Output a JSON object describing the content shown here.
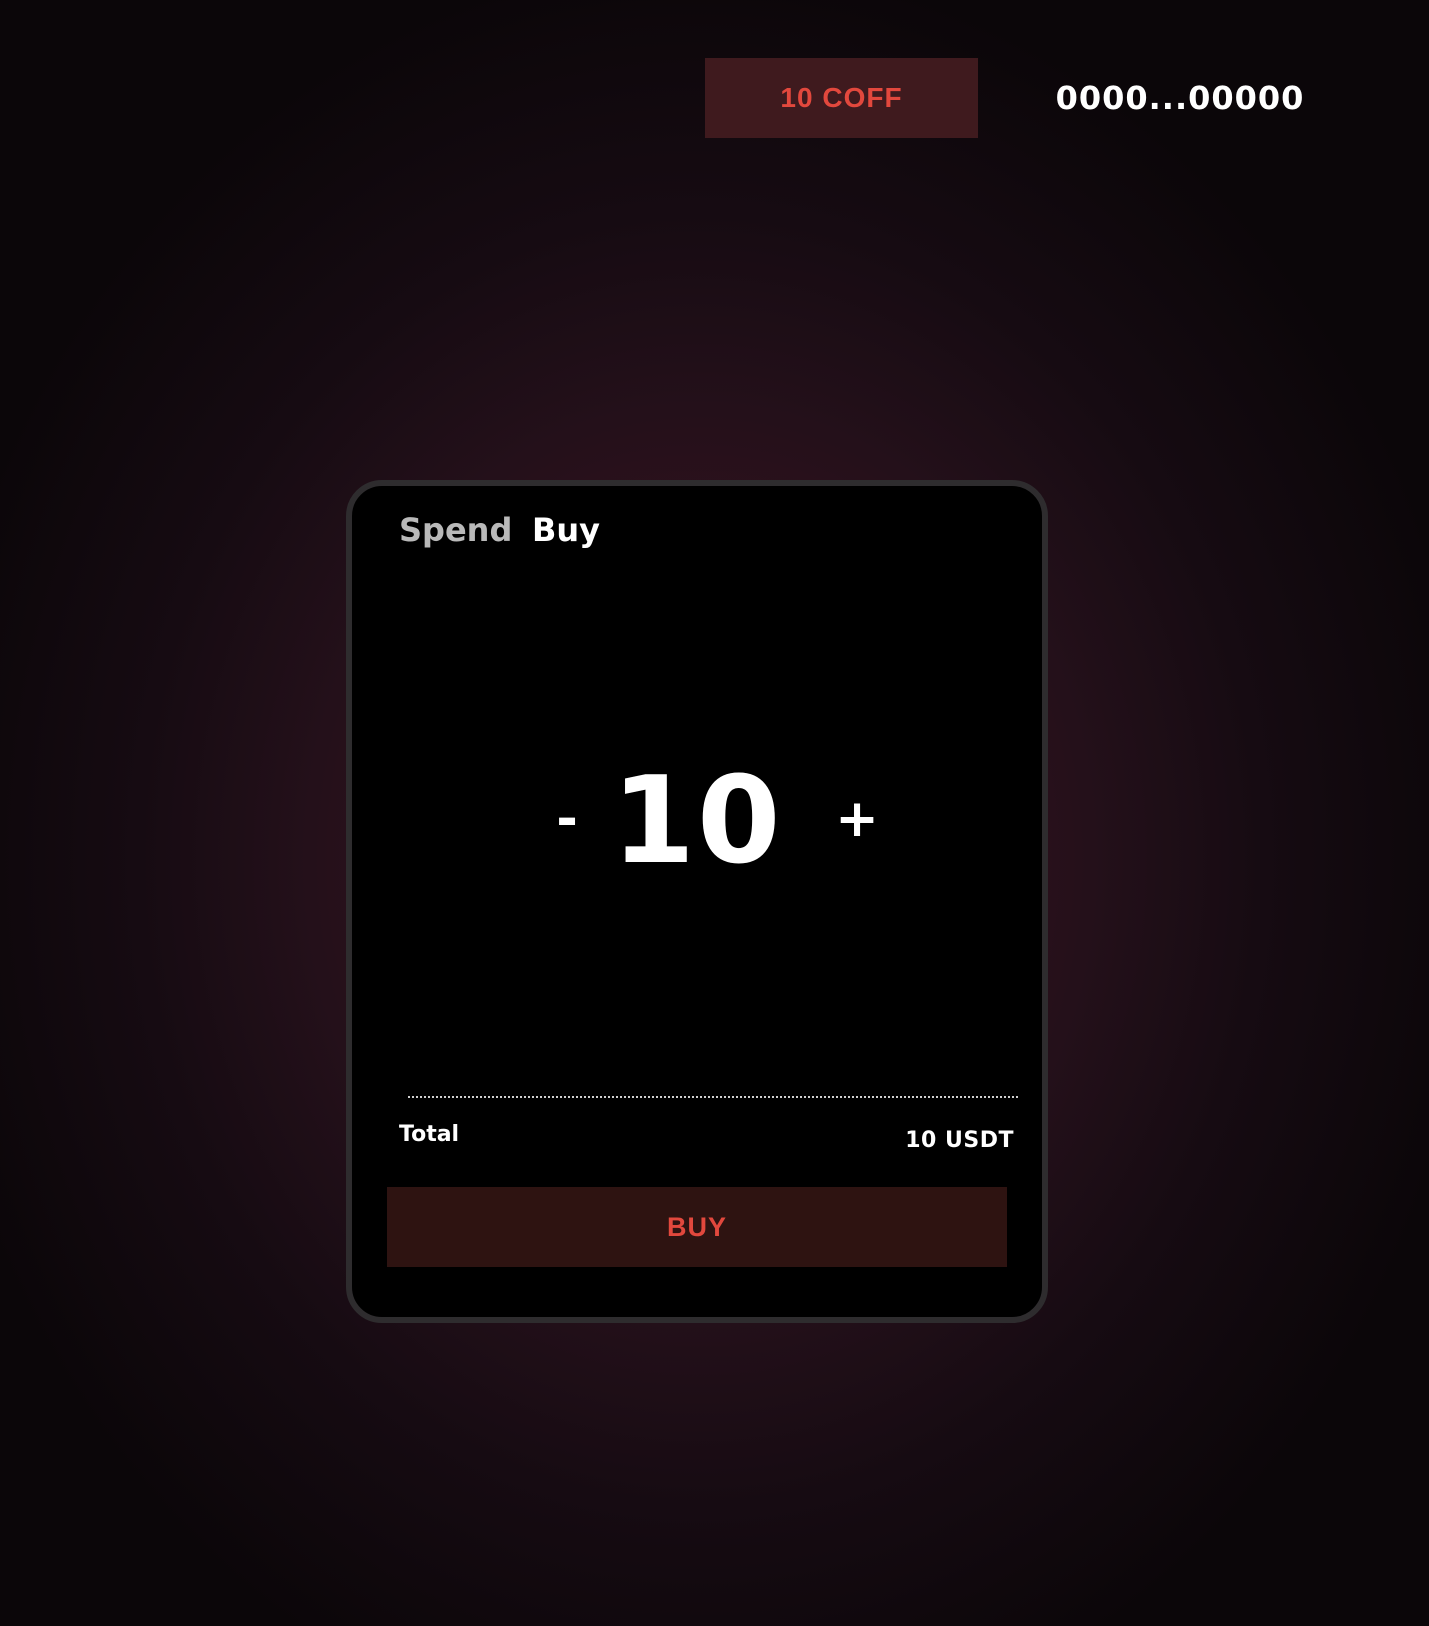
{
  "header": {
    "balance_label": "10 COFF",
    "wallet_address": "0000...00000"
  },
  "card": {
    "tabs": [
      {
        "label": "Spend",
        "active": false
      },
      {
        "label": "Buy",
        "active": true
      }
    ],
    "stepper": {
      "minus_label": "-",
      "value": "10",
      "plus_label": "+"
    },
    "total": {
      "label": "Total",
      "value": "10 USDT"
    },
    "buy_button_label": "BUY"
  },
  "colors": {
    "accent": "#e2483d",
    "badge_bg": "#3f1a1e",
    "button_bg": "#2e1311",
    "card_bg": "#000000",
    "card_border": "#2e2c2e",
    "inactive_tab": "#b9b9b9",
    "text": "#ffffff"
  }
}
